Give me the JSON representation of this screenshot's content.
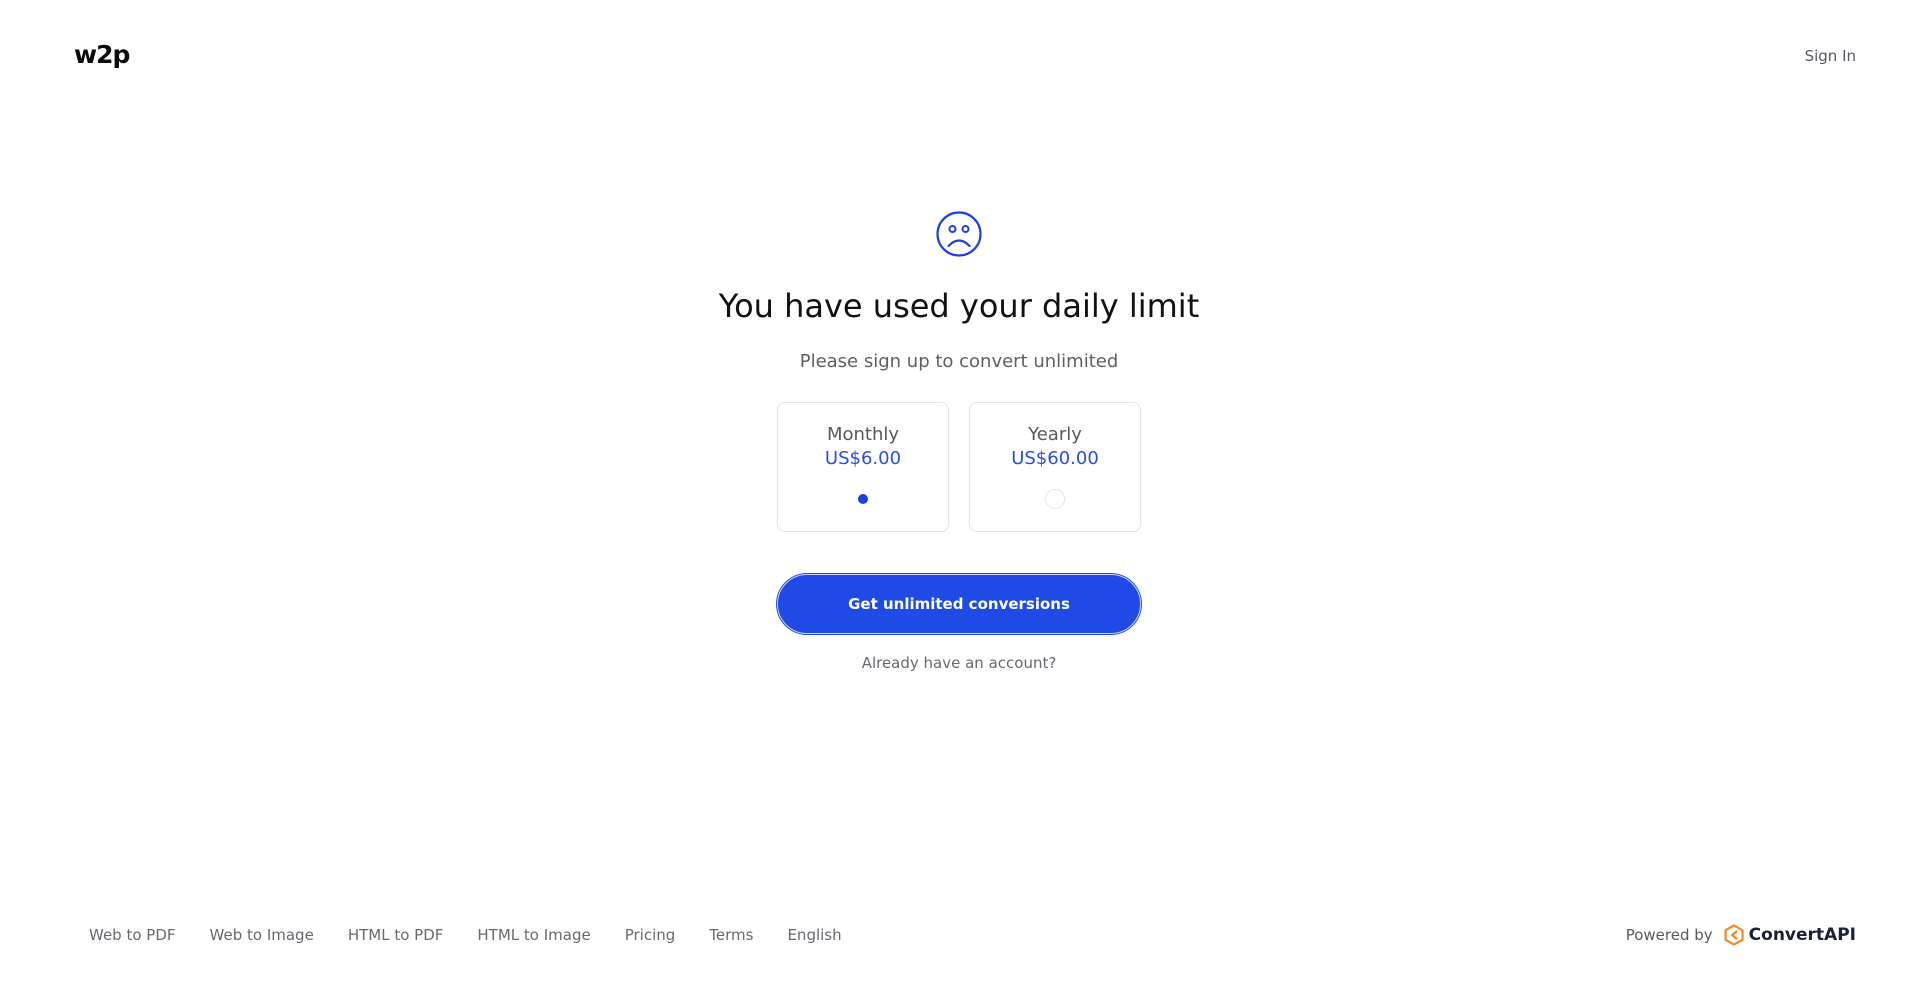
{
  "header": {
    "logo": "w2p",
    "signin_label": "Sign In"
  },
  "main": {
    "icon": "sad-face-icon",
    "title": "You have used your daily limit",
    "subtitle": "Please sign up to convert unlimited",
    "plans": [
      {
        "name": "Monthly",
        "price": "US$6.00",
        "selected": true
      },
      {
        "name": "Yearly",
        "price": "US$60.00",
        "selected": false
      }
    ],
    "cta_label": "Get unlimited conversions",
    "already_label": "Already have an account?"
  },
  "footer": {
    "links": [
      {
        "label": "Web to PDF"
      },
      {
        "label": "Web to Image"
      },
      {
        "label": "HTML to PDF"
      },
      {
        "label": "HTML to Image"
      },
      {
        "label": "Pricing"
      },
      {
        "label": "Terms"
      },
      {
        "label": "English"
      }
    ],
    "powered_label": "Powered by",
    "brand_name": "ConvertAPI"
  },
  "colors": {
    "accent": "#1f4ae6",
    "price": "#2a4de6",
    "brand_orange": "#f08a24"
  }
}
